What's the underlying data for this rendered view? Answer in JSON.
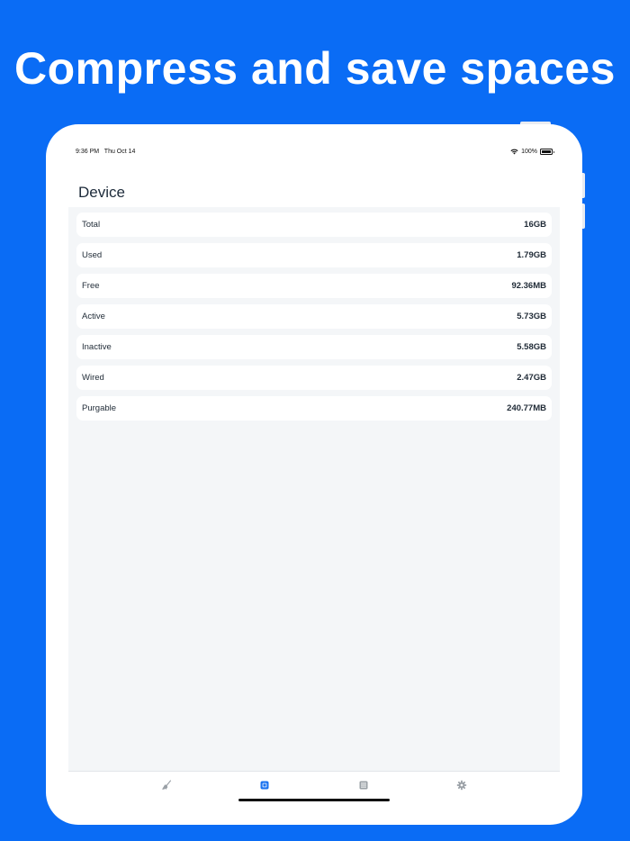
{
  "headline": "Compress and save spaces",
  "status_bar": {
    "time": "9:36 PM",
    "date": "Thu Oct 14",
    "battery": "100%"
  },
  "screen": {
    "title": "Device",
    "rows": [
      {
        "label": "Total",
        "value": "16GB"
      },
      {
        "label": "Used",
        "value": "1.79GB"
      },
      {
        "label": "Free",
        "value": "92.36MB"
      },
      {
        "label": "Active",
        "value": "5.73GB"
      },
      {
        "label": "Inactive",
        "value": "5.58GB"
      },
      {
        "label": "Wired",
        "value": "2.47GB"
      },
      {
        "label": "Purgable",
        "value": "240.77MB"
      }
    ]
  },
  "tab_bar": {
    "tabs": [
      {
        "icon": "broom-icon",
        "selected": false
      },
      {
        "icon": "memory-chip-icon",
        "selected": true
      },
      {
        "icon": "storage-icon",
        "selected": false
      },
      {
        "icon": "gear-icon",
        "selected": false
      }
    ]
  },
  "colors": {
    "background": "#0a6cf5",
    "accent": "#1a73f0",
    "tab_inactive": "#9aa0a6"
  }
}
